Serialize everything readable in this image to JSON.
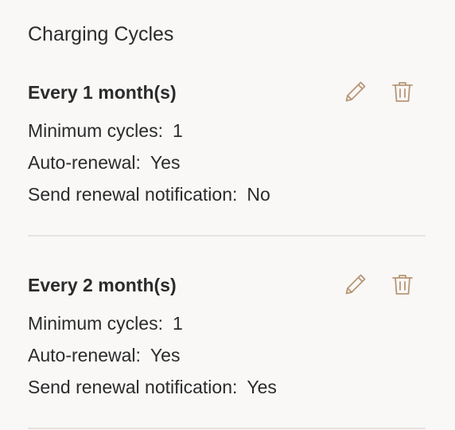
{
  "section": {
    "title": "Charging Cycles"
  },
  "cycles": [
    {
      "title": "Every 1 month(s)",
      "min_cycles_label": "Minimum cycles:",
      "min_cycles_value": "1",
      "auto_renewal_label": "Auto-renewal:",
      "auto_renewal_value": "Yes",
      "notification_label": "Send renewal notification:",
      "notification_value": "No"
    },
    {
      "title": "Every 2 month(s)",
      "min_cycles_label": "Minimum cycles:",
      "min_cycles_value": "1",
      "auto_renewal_label": "Auto-renewal:",
      "auto_renewal_value": "Yes",
      "notification_label": "Send renewal notification:",
      "notification_value": "Yes"
    }
  ],
  "icons": {
    "edit": "pencil-icon",
    "delete": "trash-icon"
  },
  "colors": {
    "background": "#f9f8f7",
    "text": "#2b2b2b",
    "icon_accent": "#b89676",
    "divider": "#e6e3e0"
  }
}
